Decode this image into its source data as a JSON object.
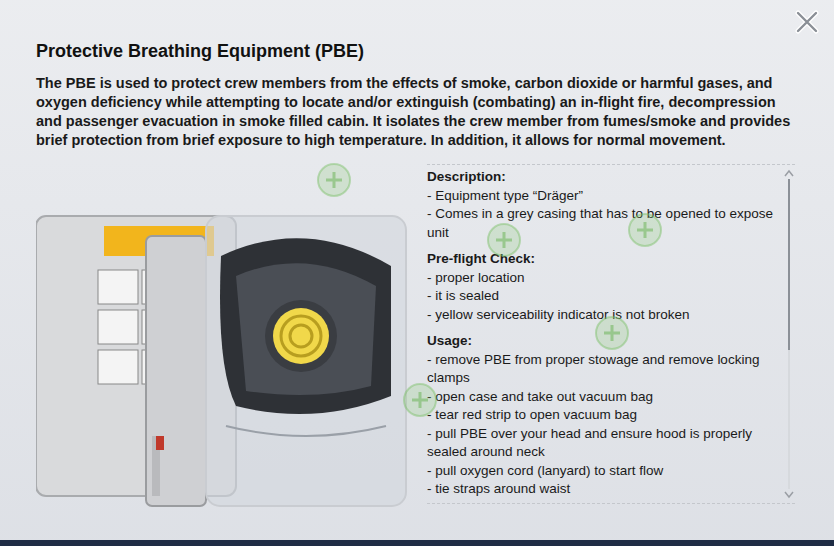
{
  "dialog": {
    "title": "Protective Breathing Equipment (PBE)",
    "intro": "The PBE is used to protect crew members from the effects of smoke, carbon dioxide or harmful gases, and oxygen deficiency while attempting to locate and/or extinguish (combating) an in-flight fire, decompression and passenger evacuation in smoke filled cabin. It isolates the crew member from fumes/smoke and provides brief protection from brief exposure to high temperature. In addition, it allows for normal movement."
  },
  "sections": [
    {
      "heading": "Description:",
      "items": [
        "- Equipment type “Dräger”",
        "- Comes in a grey casing that has to be opened to expose unit"
      ]
    },
    {
      "heading": "Pre-flight Check:",
      "items": [
        "- proper location",
        "- it is sealed",
        "- yellow serviceability indicator is not broken"
      ]
    },
    {
      "heading": "Usage:",
      "items": [
        "- remove PBE from proper stowage and remove locking clamps",
        "- open case and take out vacuum bag",
        "- tear red strip to open vacuum bag",
        "- pull PBE over your head and ensure hood is properly sealed around neck",
        "- pull oxygen cord (lanyard) to start flow",
        "- tie straps around waist"
      ]
    }
  ],
  "scrollbar": {
    "level": 0.55,
    "offset": 0
  }
}
